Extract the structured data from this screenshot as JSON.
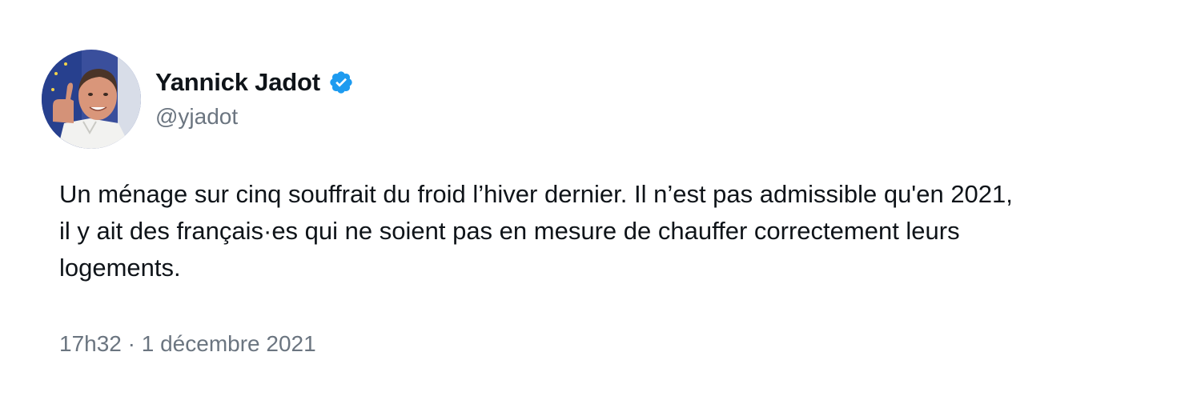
{
  "author": {
    "display_name": "Yannick Jadot",
    "handle": "@yjadot",
    "verified": true,
    "verified_color": "#1d9bf0"
  },
  "tweet": {
    "text": "Un ménage sur cinq souffrait du froid l’hiver dernier. Il n’est pas admissible qu'en 2021,\nil y ait des français·es qui ne soient pas en mesure de chauffer correctement leurs\nlogements.",
    "timestamp": "17h32 · 1 décembre 2021"
  },
  "colors": {
    "text": "#0f1419",
    "secondary_text": "#6b7580",
    "background": "#ffffff"
  }
}
